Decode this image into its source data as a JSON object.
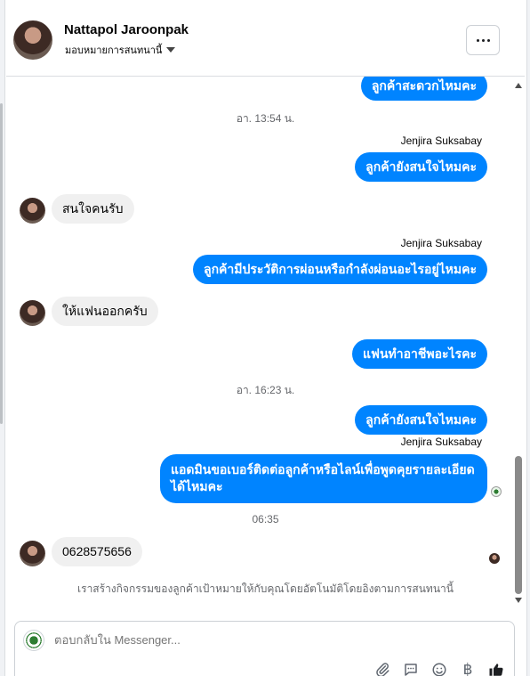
{
  "header": {
    "name": "Nattapol Jaroonpak",
    "assignee_label": "มอบหมายการสนทนานี้"
  },
  "messages": {
    "m1_text": "ลูกค้าสะดวกไหมคะ",
    "stamp1": "อา. 13:54 น.",
    "m2_sender": "Jenjira Suksabay",
    "m2_text": "ลูกค้ายังสนใจไหมคะ",
    "m3_text": "สนใจคนรับ",
    "m4_sender": "Jenjira Suksabay",
    "m4_text": "ลูกค้ามีประวัติการผ่อนหรือกำลังผ่อนอะไรอยู่ไหมคะ",
    "m5_text": "ให้แฟนออกครับ",
    "m6_text": "แฟนทำอาชีพอะไรคะ",
    "stamp2": "อา. 16:23 น.",
    "m7_text": "ลูกค้ายังสนใจไหมคะ",
    "m8_sender": "Jenjira Suksabay",
    "m8_text": "แอดมินขอเบอร์ติดต่อลูกค้าหรือไลน์เพื่อพูดคุยรายละเอียดได้ไหมคะ",
    "stamp3": "06:35",
    "m9_text": "0628575656",
    "notice": "เราสร้างกิจกรรมของลูกค้าเป้าหมายให้กับคุณโดยอัตโนมัติโดยอิงตามการสนทนานี้"
  },
  "composer": {
    "placeholder": "ตอบกลับใน Messenger...",
    "baht_symbol": "฿"
  },
  "icons": [
    "more-icon",
    "chevron-down-icon",
    "attach-icon",
    "saved-reply-icon",
    "emoji-icon",
    "baht-icon",
    "like-icon",
    "scroll-up-icon",
    "scroll-down-icon"
  ],
  "colors": {
    "outgoing_bubble": "#0084ff",
    "incoming_bubble": "#f0f0f0",
    "muted_text": "#65676b"
  }
}
